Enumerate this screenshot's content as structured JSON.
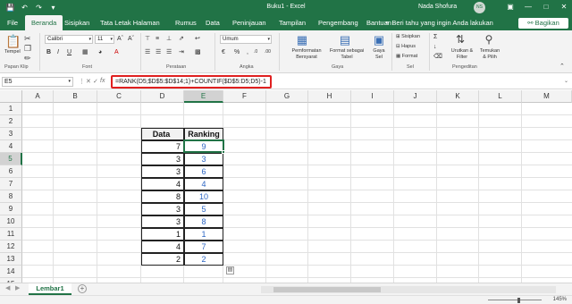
{
  "window": {
    "title": "Buku1  -  Excel",
    "user": "Nada Shofura",
    "user_initials": "NS",
    "accent": "#217346"
  },
  "tabs": [
    "File",
    "Beranda",
    "Sisipkan",
    "Tata Letak Halaman",
    "Rumus",
    "Data",
    "Peninjauan",
    "Tampilan",
    "Pengembang",
    "Bantuan"
  ],
  "active_tab": "Beranda",
  "tell_me": "Beri tahu yang ingin Anda lakukan",
  "share": "Bagikan",
  "ribbon": {
    "clipboard": {
      "paste": "Tempel",
      "label": "Papan Klip"
    },
    "font": {
      "name": "Calibri",
      "size": "11",
      "label": "Font"
    },
    "alignment": {
      "label": "Perataan"
    },
    "number": {
      "format": "Umum",
      "label": "Angka"
    },
    "styles": {
      "conditional": "Pemformatan",
      "conditional2": "Bersyarat",
      "table": "Format sebagai",
      "table2": "Tabel",
      "cell": "Gaya",
      "cell2": "Sel",
      "label": "Gaya"
    },
    "cells": {
      "insert": "Sisipkan",
      "delete": "Hapus",
      "format": "Format",
      "label": "Sel"
    },
    "editing": {
      "sort": "Urutkan &",
      "sort2": "Filter",
      "find": "Temukan",
      "find2": "& Pilih",
      "label": "Pengeditan"
    }
  },
  "formula_bar": {
    "name_box": "E5",
    "formula": "=RANK(D5;$D$5:$D$14;1)+COUNTIF($D$5:D5;D5)-1"
  },
  "columns": [
    "A",
    "B",
    "C",
    "D",
    "E",
    "F",
    "G",
    "H",
    "I",
    "J",
    "K",
    "L",
    "M"
  ],
  "rows": [
    "1",
    "2",
    "3",
    "4",
    "5",
    "6",
    "7",
    "8",
    "9",
    "10",
    "11",
    "12",
    "13",
    "14",
    "15"
  ],
  "table": {
    "headers": [
      "Data",
      "Ranking"
    ],
    "data": [
      "7",
      "3",
      "3",
      "4",
      "3",
      "8",
      "3",
      "3",
      "1",
      "4",
      "2"
    ],
    "ranking": [
      "9",
      "3",
      "6",
      "10",
      "4",
      "5",
      "8",
      "1",
      "7",
      "2"
    ],
    "rows": [
      {
        "data": "7",
        "ranking": "9"
      },
      {
        "data": "3",
        "ranking": "3"
      },
      {
        "data": "3",
        "ranking": "6"
      },
      {
        "data": "4",
        "ranking": "4"
      },
      {
        "data": "8",
        "ranking": "10"
      },
      {
        "data": "3",
        "ranking": "5"
      },
      {
        "data": "3",
        "ranking": "8"
      },
      {
        "data": "1",
        "ranking": "1"
      },
      {
        "data": "4",
        "ranking": "7"
      },
      {
        "data": "2",
        "ranking": "2"
      }
    ],
    "ranking_color": "#2e67c4"
  },
  "sheet_tab": "Lembar1",
  "zoom": "145%"
}
